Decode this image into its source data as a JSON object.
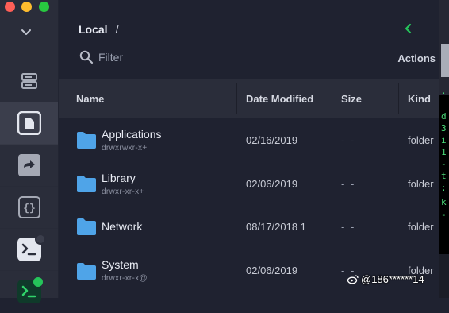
{
  "window": {
    "controls": {
      "close_color": "#ff5f57",
      "minimize_color": "#febc2e",
      "zoom_color": "#28c840"
    }
  },
  "sidebar": {
    "items": [
      {
        "name": "hosts-icon"
      },
      {
        "name": "sftp-icon",
        "active": true
      },
      {
        "name": "port-forwarding-icon"
      },
      {
        "name": "snippets-icon"
      },
      {
        "name": "terminal-session-icon"
      },
      {
        "name": "terminal-session-active-icon"
      }
    ],
    "accent_green": "#25c45a"
  },
  "main": {
    "breadcrumb": {
      "location": "Local",
      "separator": "/"
    },
    "filter": {
      "placeholder": "Filter"
    },
    "actions_label": "Actions",
    "columns": {
      "name": "Name",
      "date": "Date Modified",
      "size": "Size",
      "kind": "Kind"
    },
    "rows": [
      {
        "name": "Applications",
        "perm": "drwxrwxr-x+",
        "date": "02/16/2019",
        "size": "- -",
        "kind": "folder"
      },
      {
        "name": "Library",
        "perm": "drwxr-xr-x+",
        "date": "02/06/2019",
        "size": "- -",
        "kind": "folder"
      },
      {
        "name": "Network",
        "perm": "",
        "date": "08/17/2018 1",
        "size": "- -",
        "kind": "folder"
      },
      {
        "name": "System",
        "perm": "drwxr-xr-x@",
        "date": "02/06/2019",
        "size": "- -",
        "kind": "folder"
      }
    ]
  },
  "overflow": {
    "glyphs": [
      ".",
      "d",
      "3",
      "i",
      "1",
      "-",
      "t",
      ":",
      "k",
      "-"
    ]
  },
  "watermark": {
    "text": "@186******14"
  }
}
